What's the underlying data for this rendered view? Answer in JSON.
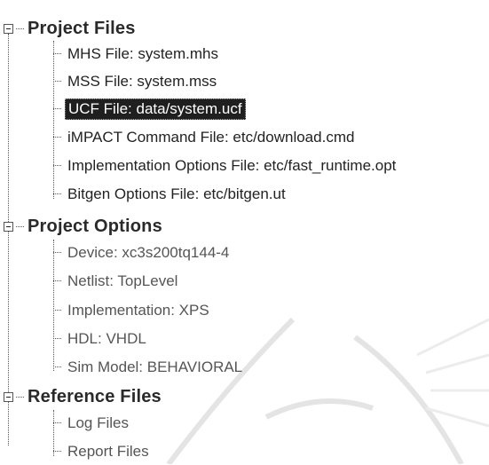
{
  "tree": {
    "groups": [
      {
        "label": "Project Files",
        "items": [
          "MHS File: system.mhs",
          "MSS File: system.mss",
          "UCF File: data/system.ucf",
          "iMPACT Command File: etc/download.cmd",
          "Implementation Options File: etc/fast_runtime.opt",
          "Bitgen Options File: etc/bitgen.ut"
        ],
        "selected_index": 2
      },
      {
        "label": "Project Options",
        "items": [
          "Device: xc3s200tq144-4",
          "Netlist: TopLevel",
          "Implementation: XPS",
          "HDL: VHDL",
          "Sim Model: BEHAVIORAL"
        ]
      },
      {
        "label": "Reference Files",
        "items": [
          "Log Files",
          "Report Files"
        ]
      }
    ]
  }
}
